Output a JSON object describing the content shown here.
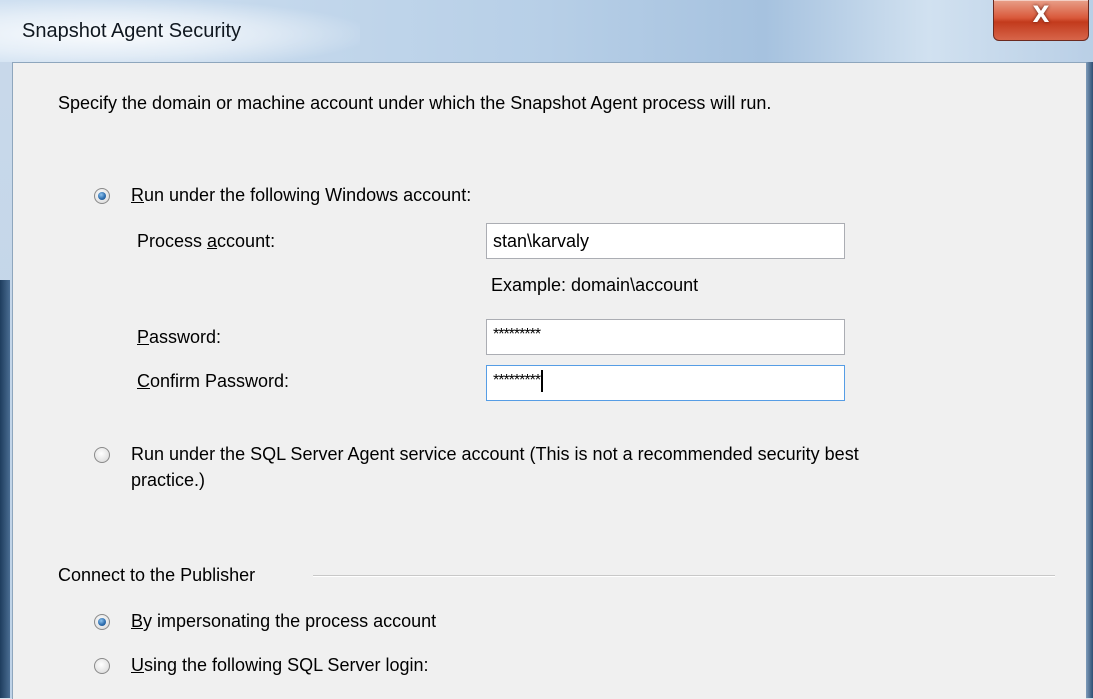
{
  "window": {
    "title": "Snapshot Agent Security",
    "close_glyph": "X"
  },
  "dialog": {
    "description": "Specify the domain or machine account under which the Snapshot Agent process will run.",
    "run_windows_account": {
      "label": "Run under the following Windows account:",
      "selected": true,
      "process_account_label": "Process account:",
      "process_account_value": "stan\\karvaly",
      "example_text": "Example: domain\\account",
      "password_label": "Password:",
      "password_value": "*********",
      "confirm_password_label": "Confirm Password:",
      "confirm_password_value": "*********"
    },
    "run_agent_service": {
      "label_line1": "Run under the SQL Server Agent service account (This is not a recommended security best",
      "label_line2": "practice.)",
      "selected": false
    },
    "connect_publisher": {
      "group_label": "Connect to the Publisher",
      "impersonate_label": "By impersonating the process account",
      "impersonate_selected": true,
      "sql_login_label": "Using the following SQL Server login:",
      "sql_login_selected": false
    }
  },
  "icons": {
    "close": "close-icon",
    "radio_selected": "radio-selected",
    "radio_unselected": "radio-unselected"
  }
}
